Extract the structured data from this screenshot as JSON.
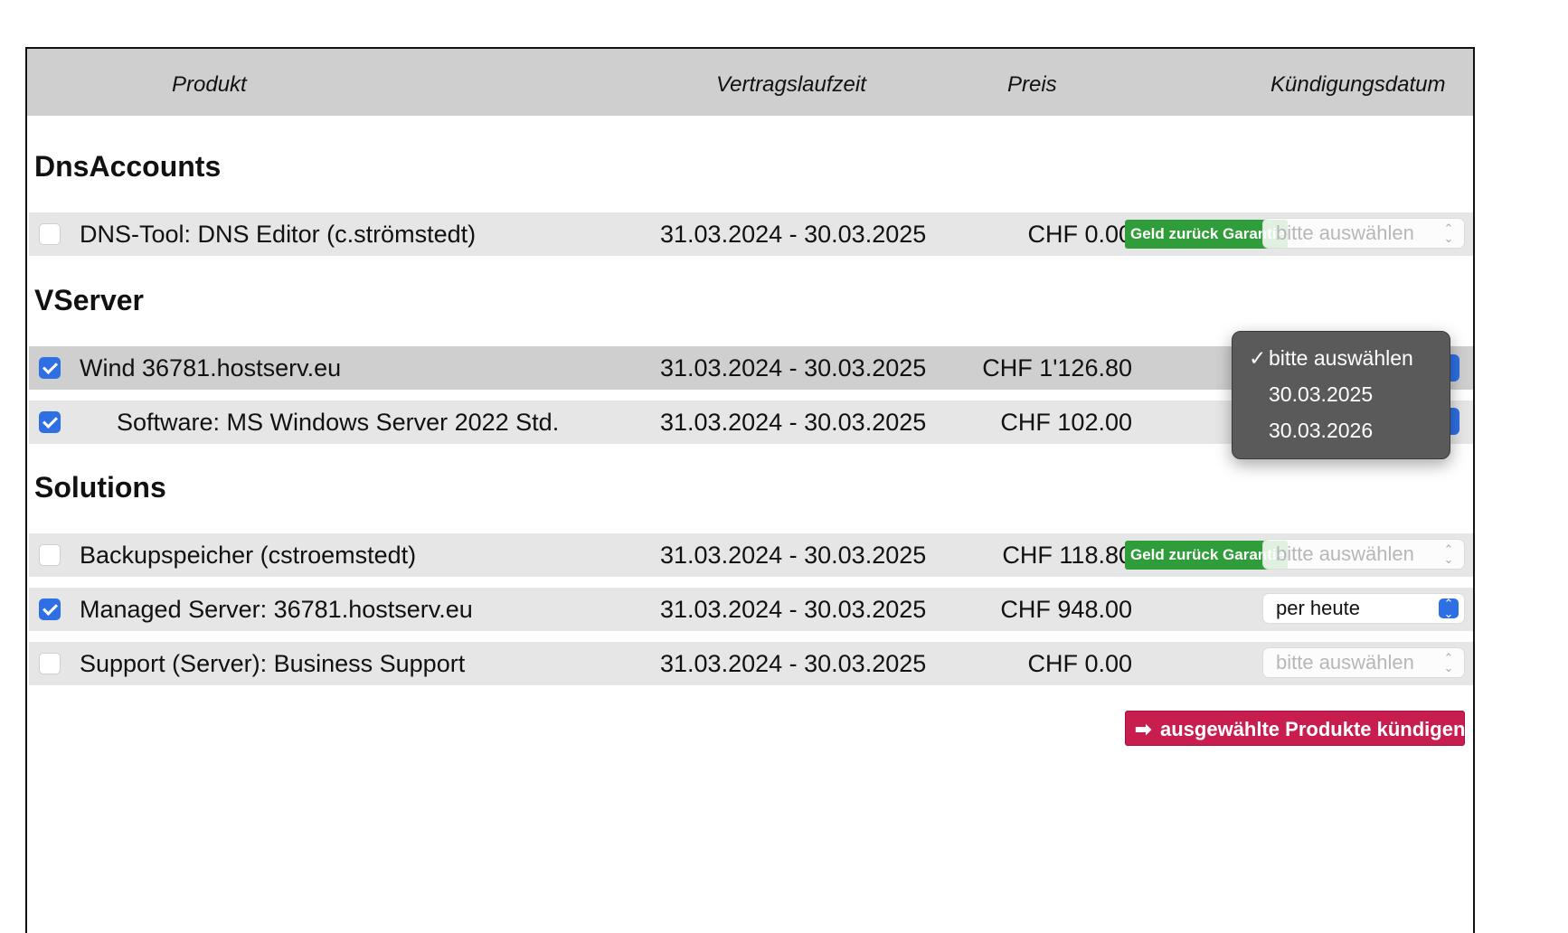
{
  "header": {
    "produkt": "Produkt",
    "laufzeit": "Vertragslaufzeit",
    "preis": "Preis",
    "kuendigung": "Kündigungsdatum"
  },
  "groups": {
    "dns": "DnsAccounts",
    "vserver": "VServer",
    "solutions": "Solutions"
  },
  "rows": [
    {
      "name": "DNS-Tool: DNS Editor (c.strömstedt)",
      "period": "31.03.2024 - 30.03.2025",
      "price": "CHF 0.00",
      "checked": false,
      "badge": "Geld zurück Garantie",
      "select": "bitte auswählen"
    },
    {
      "name": "Wind 36781.hostserv.eu",
      "period": "31.03.2024 - 30.03.2025",
      "price": "CHF 1'126.80",
      "checked": true
    },
    {
      "name": "Software: MS Windows Server 2022 Std.",
      "period": "31.03.2024 - 30.03.2025",
      "price": "CHF 102.00",
      "checked": true
    },
    {
      "name": "Backupspeicher (cstroemstedt)",
      "period": "31.03.2024 - 30.03.2025",
      "price": "CHF 118.80",
      "checked": false,
      "badge": "Geld zurück Garantie",
      "select": "bitte auswählen"
    },
    {
      "name": "Managed Server: 36781.hostserv.eu",
      "period": "31.03.2024 - 30.03.2025",
      "price": "CHF 948.00",
      "checked": true,
      "select": "per heute"
    },
    {
      "name": "Support (Server): Business Support",
      "period": "31.03.2024 - 30.03.2025",
      "price": "CHF 0.00",
      "checked": false,
      "select": "bitte auswählen"
    }
  ],
  "dropdown": {
    "options": [
      "bitte auswählen",
      "30.03.2025",
      "30.03.2026"
    ],
    "selected": "bitte auswählen"
  },
  "action": {
    "label": "ausgewählte Produkte kündigen"
  },
  "colors": {
    "accent": "#2f6fe4",
    "badge": "#2f9d3a",
    "button": "#c81d4f"
  }
}
